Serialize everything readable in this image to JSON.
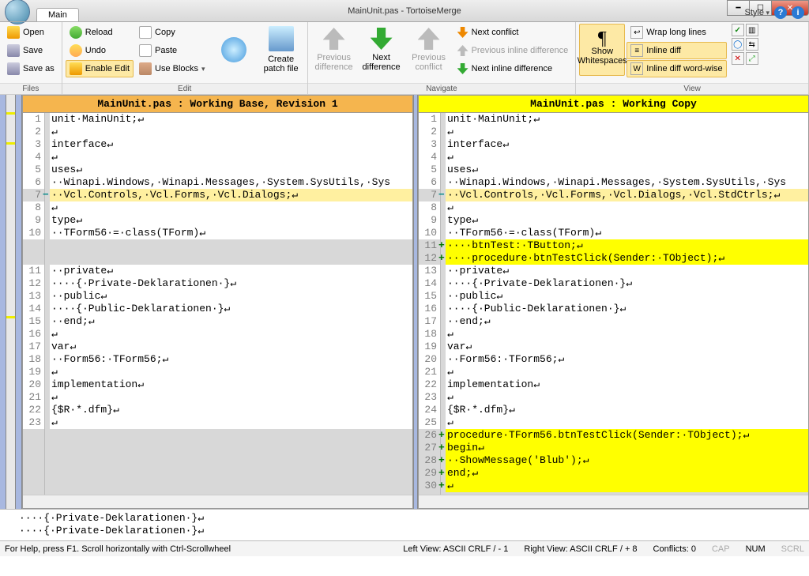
{
  "window": {
    "title": "MainUnit.pas - TortoiseMerge"
  },
  "tabs": {
    "main": "Main",
    "style": "Style"
  },
  "ribbon": {
    "files": {
      "label": "Files",
      "open": "Open",
      "save": "Save",
      "save_as": "Save as"
    },
    "edit": {
      "label": "Edit",
      "reload": "Reload",
      "undo": "Undo",
      "enable_edit": "Enable Edit",
      "copy": "Copy",
      "paste": "Paste",
      "use_blocks": "Use Blocks",
      "create_patch": "Create\npatch file"
    },
    "navigate": {
      "label": "Navigate",
      "prev_diff": "Previous\ndifference",
      "next_diff": "Next\ndifference",
      "prev_conf": "Previous\nconflict",
      "next_conf": "Next conflict",
      "prev_inline": "Previous inline difference",
      "next_inline": "Next inline difference"
    },
    "view": {
      "label": "View",
      "show_ws": "Show\nWhitespaces",
      "wrap": "Wrap long lines",
      "inline_diff": "Inline diff",
      "inline_word": "Inline diff word-wise"
    }
  },
  "panes": {
    "left_title": "MainUnit.pas : Working Base, Revision 1",
    "right_title": "MainUnit.pas : Working Copy"
  },
  "left_lines": [
    {
      "n": 1,
      "t": "unit·MainUnit;↵",
      "cls": "white"
    },
    {
      "n": 2,
      "t": "↵",
      "cls": "white"
    },
    {
      "n": 3,
      "t": "interface↵",
      "cls": "white"
    },
    {
      "n": 4,
      "t": "↵",
      "cls": "white"
    },
    {
      "n": 5,
      "t": "uses↵",
      "cls": "white"
    },
    {
      "n": 6,
      "t": "··Winapi.Windows,·Winapi.Messages,·System.SysUtils,·Sys",
      "cls": "white"
    },
    {
      "n": 7,
      "t": "··Vcl.Controls,·Vcl.Forms,·Vcl.Dialogs;↵",
      "cls": "modified-hl modmark"
    },
    {
      "n": 8,
      "t": "↵",
      "cls": "white"
    },
    {
      "n": 9,
      "t": "type↵",
      "cls": "white"
    },
    {
      "n": 10,
      "t": "··TForm56·=·class(TForm)↵",
      "cls": "white"
    },
    {
      "n": "",
      "t": "",
      "cls": ""
    },
    {
      "n": "",
      "t": "",
      "cls": ""
    },
    {
      "n": 11,
      "t": "··private↵",
      "cls": "white"
    },
    {
      "n": 12,
      "t": "····{·Private-Deklarationen·}↵",
      "cls": "white"
    },
    {
      "n": 13,
      "t": "··public↵",
      "cls": "white"
    },
    {
      "n": 14,
      "t": "····{·Public-Deklarationen·}↵",
      "cls": "white"
    },
    {
      "n": 15,
      "t": "··end;↵",
      "cls": "white"
    },
    {
      "n": 16,
      "t": "↵",
      "cls": "white"
    },
    {
      "n": 17,
      "t": "var↵",
      "cls": "white"
    },
    {
      "n": 18,
      "t": "··Form56:·TForm56;↵",
      "cls": "white"
    },
    {
      "n": 19,
      "t": "↵",
      "cls": "white"
    },
    {
      "n": 20,
      "t": "implementation↵",
      "cls": "white"
    },
    {
      "n": 21,
      "t": "↵",
      "cls": "white"
    },
    {
      "n": 22,
      "t": "{$R·*.dfm}↵",
      "cls": "white"
    },
    {
      "n": 23,
      "t": "↵",
      "cls": "white"
    },
    {
      "n": "",
      "t": "",
      "cls": ""
    },
    {
      "n": "",
      "t": "",
      "cls": ""
    },
    {
      "n": "",
      "t": "",
      "cls": ""
    },
    {
      "n": "",
      "t": "",
      "cls": ""
    },
    {
      "n": "",
      "t": "",
      "cls": ""
    },
    {
      "n": "",
      "t": "",
      "cls": ""
    }
  ],
  "right_lines": [
    {
      "n": 1,
      "t": "unit·MainUnit;↵",
      "cls": "white"
    },
    {
      "n": 2,
      "t": "↵",
      "cls": "white"
    },
    {
      "n": 3,
      "t": "interface↵",
      "cls": "white"
    },
    {
      "n": 4,
      "t": "↵",
      "cls": "white"
    },
    {
      "n": 5,
      "t": "uses↵",
      "cls": "white"
    },
    {
      "n": 6,
      "t": "··Winapi.Windows,·Winapi.Messages,·System.SysUtils,·Sys",
      "cls": "white"
    },
    {
      "n": 7,
      "t": "··Vcl.Controls,·Vcl.Forms,·Vcl.Dialogs,·Vcl.StdCtrls;↵",
      "cls": "modified-hl modmark"
    },
    {
      "n": 8,
      "t": "↵",
      "cls": "white"
    },
    {
      "n": 9,
      "t": "type↵",
      "cls": "white"
    },
    {
      "n": 10,
      "t": "··TForm56·=·class(TForm)↵",
      "cls": "white"
    },
    {
      "n": 11,
      "t": "····btnTest:·TButton;↵",
      "cls": "added addmark"
    },
    {
      "n": 12,
      "t": "····procedure·btnTestClick(Sender:·TObject);↵",
      "cls": "added addmark"
    },
    {
      "n": 13,
      "t": "··private↵",
      "cls": "white"
    },
    {
      "n": 14,
      "t": "····{·Private-Deklarationen·}↵",
      "cls": "white"
    },
    {
      "n": 15,
      "t": "··public↵",
      "cls": "white"
    },
    {
      "n": 16,
      "t": "····{·Public-Deklarationen·}↵",
      "cls": "white"
    },
    {
      "n": 17,
      "t": "··end;↵",
      "cls": "white"
    },
    {
      "n": 18,
      "t": "↵",
      "cls": "white"
    },
    {
      "n": 19,
      "t": "var↵",
      "cls": "white"
    },
    {
      "n": 20,
      "t": "··Form56:·TForm56;↵",
      "cls": "white"
    },
    {
      "n": 21,
      "t": "↵",
      "cls": "white"
    },
    {
      "n": 22,
      "t": "implementation↵",
      "cls": "white"
    },
    {
      "n": 23,
      "t": "↵",
      "cls": "white"
    },
    {
      "n": 24,
      "t": "{$R·*.dfm}↵",
      "cls": "white"
    },
    {
      "n": 25,
      "t": "↵",
      "cls": "white"
    },
    {
      "n": 26,
      "t": "procedure·TForm56.btnTestClick(Sender:·TObject);↵",
      "cls": "added addmark"
    },
    {
      "n": 27,
      "t": "begin↵",
      "cls": "added addmark"
    },
    {
      "n": 28,
      "t": "··ShowMessage('Blub');↵",
      "cls": "added addmark"
    },
    {
      "n": 29,
      "t": "end;↵",
      "cls": "added addmark"
    },
    {
      "n": 30,
      "t": "↵",
      "cls": "added addmark"
    },
    {
      "n": "",
      "t": "",
      "cls": ""
    }
  ],
  "context": {
    "line1": "····{·Private-Deklarationen·}↵",
    "line2": "····{·Private-Deklarationen·}↵"
  },
  "status": {
    "help": "For Help, press F1. Scroll horizontally with Ctrl-Scrollwheel",
    "left": "Left View: ASCII CRLF  / - 1",
    "right": "Right View: ASCII CRLF  / + 8",
    "conflicts": "Conflicts: 0",
    "cap": "CAP",
    "num": "NUM",
    "scrl": "SCRL"
  }
}
